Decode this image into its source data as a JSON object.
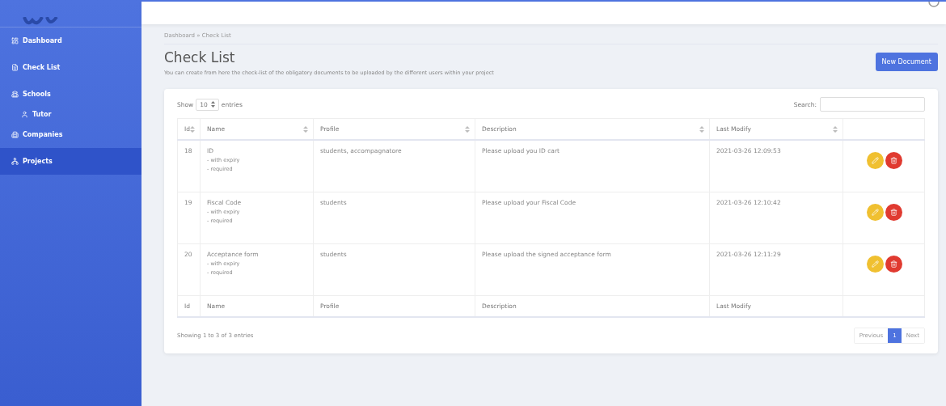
{
  "sidebar": {
    "items": [
      {
        "label": "Dashboard",
        "selected": false
      },
      {
        "label": "Check List",
        "selected": false
      },
      {
        "label": "Schools",
        "selected": false,
        "children": [
          {
            "label": "Tutor",
            "selected": false
          }
        ]
      },
      {
        "label": "Companies",
        "selected": false
      },
      {
        "label": "Projects",
        "selected": true
      }
    ]
  },
  "breadcrumb": "Dashboard » Check List",
  "page": {
    "title": "Check List",
    "subtitle": "You can create from here the check-list of the obligatory documents to be uploaded by the different users within your project",
    "new_button": "New Document"
  },
  "table_controls": {
    "show": "Show",
    "page_size": "10",
    "entries": "entries",
    "search_label": "Search:"
  },
  "table": {
    "columns": [
      "Id",
      "Name",
      "Profile",
      "Description",
      "Last Modify"
    ],
    "rows": [
      {
        "id": "18",
        "name": "ID",
        "notes": [
          "- with expiry",
          "- required"
        ],
        "profile": "students, accompagnatore",
        "description": "Please upload you ID cart",
        "modified": "2021-03-26 12:09:53"
      },
      {
        "id": "19",
        "name": "Fiscal Code",
        "notes": [
          "- with expiry",
          "- required"
        ],
        "profile": "students",
        "description": "Please upload your Fiscal Code",
        "modified": "2021-03-26 12:10:42"
      },
      {
        "id": "20",
        "name": "Acceptance form",
        "notes": [
          "- with expiry",
          "- required"
        ],
        "profile": "students",
        "description": "Please upload the signed acceptance form",
        "modified": "2021-03-26 12:11:29"
      }
    ],
    "footer": [
      "Id",
      "Name",
      "Profile",
      "Description",
      "Last Modify"
    ]
  },
  "info": "Showing 1 to 3 of 3 entries",
  "pagination": [
    {
      "label": "Previous",
      "selected": false
    },
    {
      "label": "1",
      "selected": true
    },
    {
      "label": "Next",
      "selected": false
    }
  ]
}
